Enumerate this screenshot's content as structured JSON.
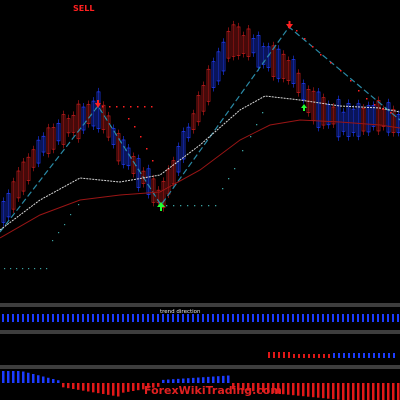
{
  "header": {
    "signal_label": "SELL"
  },
  "panels": {
    "trend": {
      "label": "trend direction"
    },
    "bottom": {
      "watermark": "ForexWikiTrading.com"
    }
  },
  "colors": {
    "background": "#000000",
    "sell_signal": "#ff2020",
    "buy_signal": "#22ff33",
    "zigzag": "#2a8aa6",
    "ma_fast": "#d8d8d8",
    "ma_slow": "#9a1515",
    "bull_candle": "#1e3cff",
    "bear_candle": "#c81c1c",
    "histogram_pos": "#1c3cff",
    "histogram_neg": "#e01818",
    "panel_border": "#7a7a7a"
  },
  "icons": {
    "sell_arrow": "arrow-down-icon",
    "buy_arrow": "arrow-up-icon"
  }
}
